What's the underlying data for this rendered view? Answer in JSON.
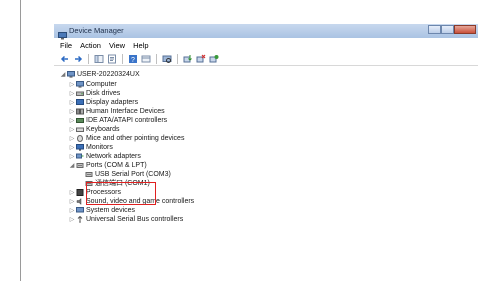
{
  "window": {
    "title": "Device Manager",
    "menu": [
      "File",
      "Action",
      "View",
      "Help"
    ]
  },
  "tree": {
    "root": "USER-20220324UX",
    "items": [
      "Computer",
      "Disk drives",
      "Display adapters",
      "Human Interface Devices",
      "IDE ATA/ATAPI controllers",
      "Keyboards",
      "Mice and other pointing devices",
      "Monitors",
      "Network adapters",
      "Ports (COM & LPT)",
      "USB Serial Port (COM3)",
      "通信端口 (COM1)",
      "Processors",
      "Sound, video and game controllers",
      "System devices",
      "Universal Serial Bus controllers"
    ]
  },
  "colors": {
    "highlight": "#e02020",
    "titlebar": "#aac3e3"
  }
}
